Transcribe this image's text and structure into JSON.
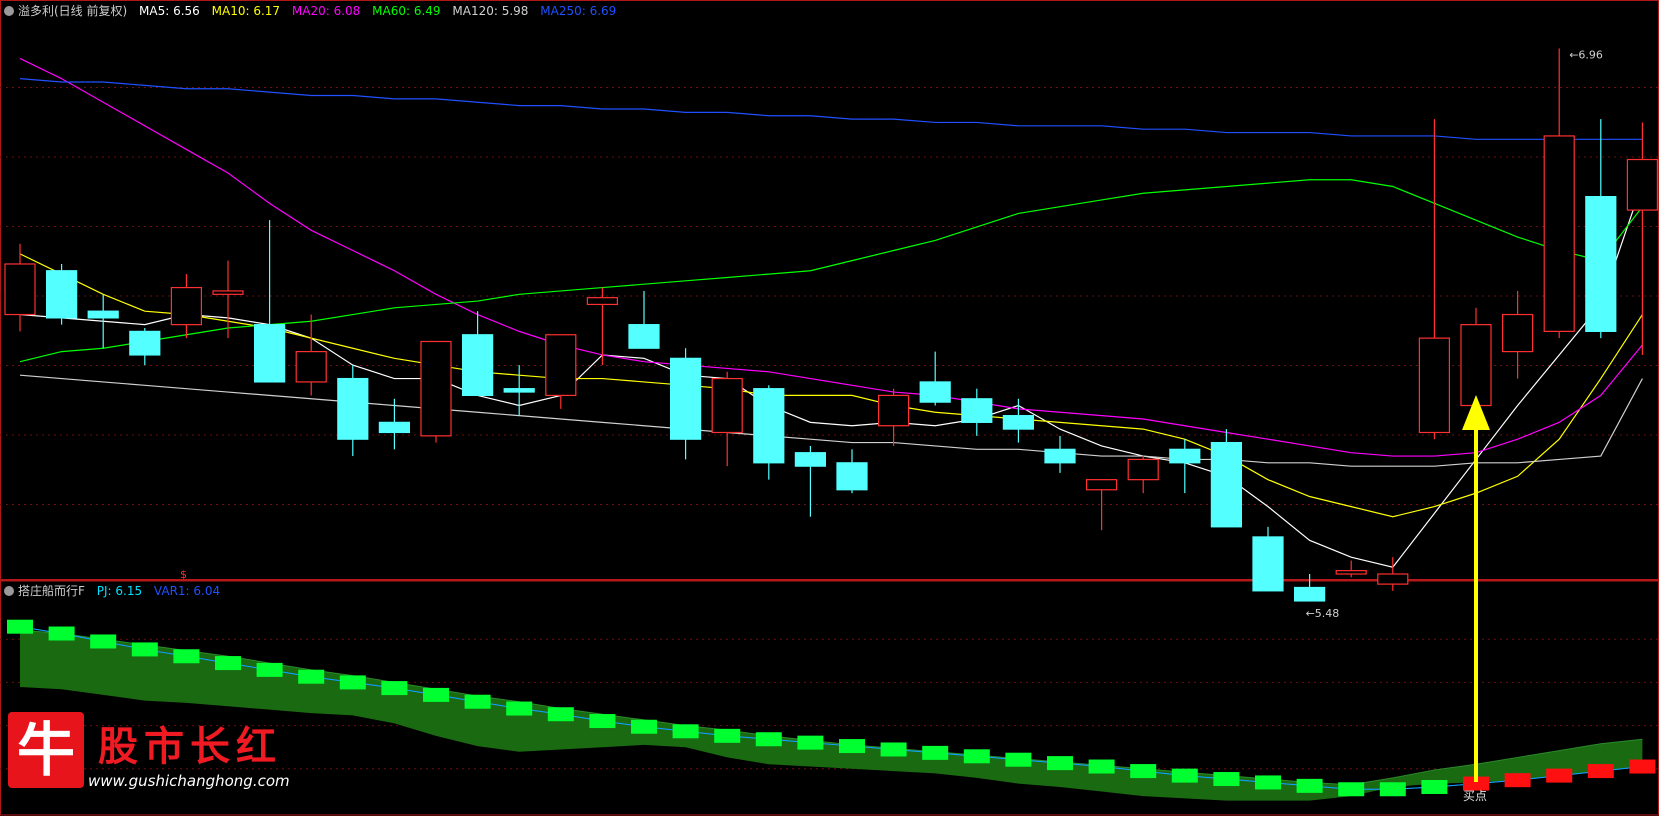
{
  "header": {
    "title": "溢多利(日线 前复权)",
    "indicators": [
      {
        "label": "MA5: 6.56",
        "color": "#ffffff"
      },
      {
        "label": "MA10: 6.17",
        "color": "#ffff00"
      },
      {
        "label": "MA20: 6.08",
        "color": "#ff00ff"
      },
      {
        "label": "MA60: 6.49",
        "color": "#00ff00"
      },
      {
        "label": "MA120: 5.98",
        "color": "#d0d0d0"
      },
      {
        "label": "MA250: 6.69",
        "color": "#2050ff"
      }
    ]
  },
  "subheader": {
    "title": "搭庄船而行F",
    "indicators": [
      {
        "label": "PJ: 6.15",
        "color": "#00e0ff"
      },
      {
        "label": "VAR1: 6.04",
        "color": "#2050ff"
      }
    ]
  },
  "watermark": {
    "logo_char": "牛",
    "name": "股市长红",
    "url": "www.gushichanghong.com"
  },
  "chart_data": [
    {
      "type": "candlestick",
      "panel": "main",
      "ylim": [
        5.4,
        7.05
      ],
      "up_color": "#ff3030",
      "down_color": "#54ffff",
      "candles": [
        {
          "o": 6.17,
          "h": 6.38,
          "l": 6.12,
          "c": 6.32
        },
        {
          "o": 6.3,
          "h": 6.32,
          "l": 6.14,
          "c": 6.16
        },
        {
          "o": 6.18,
          "h": 6.23,
          "l": 6.07,
          "c": 6.16
        },
        {
          "o": 6.12,
          "h": 6.13,
          "l": 6.02,
          "c": 6.05
        },
        {
          "o": 6.14,
          "h": 6.29,
          "l": 6.1,
          "c": 6.25
        },
        {
          "o": 6.23,
          "h": 6.33,
          "l": 6.1,
          "c": 6.24
        },
        {
          "o": 6.14,
          "h": 6.45,
          "l": 5.97,
          "c": 5.97
        },
        {
          "o": 5.97,
          "h": 6.17,
          "l": 5.93,
          "c": 6.06
        },
        {
          "o": 5.98,
          "h": 6.02,
          "l": 5.75,
          "c": 5.8
        },
        {
          "o": 5.85,
          "h": 5.92,
          "l": 5.77,
          "c": 5.82
        },
        {
          "o": 5.81,
          "h": 6.09,
          "l": 5.79,
          "c": 6.09
        },
        {
          "o": 6.11,
          "h": 6.18,
          "l": 5.93,
          "c": 5.93
        },
        {
          "o": 5.95,
          "h": 6.02,
          "l": 5.87,
          "c": 5.94
        },
        {
          "o": 5.93,
          "h": 6.11,
          "l": 5.89,
          "c": 6.11
        },
        {
          "o": 6.2,
          "h": 6.25,
          "l": 6.02,
          "c": 6.22
        },
        {
          "o": 6.14,
          "h": 6.24,
          "l": 6.07,
          "c": 6.07
        },
        {
          "o": 6.04,
          "h": 6.07,
          "l": 5.74,
          "c": 5.8
        },
        {
          "o": 5.82,
          "h": 6.0,
          "l": 5.72,
          "c": 5.98
        },
        {
          "o": 5.95,
          "h": 5.96,
          "l": 5.68,
          "c": 5.73
        },
        {
          "o": 5.76,
          "h": 5.78,
          "l": 5.57,
          "c": 5.72
        },
        {
          "o": 5.73,
          "h": 5.77,
          "l": 5.64,
          "c": 5.65
        },
        {
          "o": 5.84,
          "h": 5.95,
          "l": 5.78,
          "c": 5.93
        },
        {
          "o": 5.97,
          "h": 6.06,
          "l": 5.9,
          "c": 5.91
        },
        {
          "o": 5.92,
          "h": 5.95,
          "l": 5.81,
          "c": 5.85
        },
        {
          "o": 5.87,
          "h": 5.92,
          "l": 5.79,
          "c": 5.83
        },
        {
          "o": 5.77,
          "h": 5.81,
          "l": 5.7,
          "c": 5.73
        },
        {
          "o": 5.65,
          "h": 5.68,
          "l": 5.53,
          "c": 5.68
        },
        {
          "o": 5.68,
          "h": 5.75,
          "l": 5.64,
          "c": 5.74
        },
        {
          "o": 5.77,
          "h": 5.8,
          "l": 5.64,
          "c": 5.73
        },
        {
          "o": 5.79,
          "h": 5.83,
          "l": 5.54,
          "c": 5.54
        },
        {
          "o": 5.51,
          "h": 5.54,
          "l": 5.35,
          "c": 5.35
        },
        {
          "o": 5.36,
          "h": 5.4,
          "l": 5.48,
          "c": 5.32
        },
        {
          "o": 5.4,
          "h": 5.44,
          "l": 5.39,
          "c": 5.41
        },
        {
          "o": 5.37,
          "h": 5.45,
          "l": 5.35,
          "c": 5.4
        },
        {
          "o": 5.82,
          "h": 6.75,
          "l": 5.8,
          "c": 6.1
        },
        {
          "o": 5.9,
          "h": 6.19,
          "l": 5.88,
          "c": 6.14
        },
        {
          "o": 6.06,
          "h": 6.24,
          "l": 5.98,
          "c": 6.17
        },
        {
          "o": 6.12,
          "h": 6.96,
          "l": 6.1,
          "c": 6.7
        },
        {
          "o": 6.52,
          "h": 6.75,
          "l": 6.1,
          "c": 6.12
        },
        {
          "o": 6.48,
          "h": 6.74,
          "l": 6.05,
          "c": 6.63
        }
      ],
      "ma_lines": [
        {
          "name": "MA5",
          "color": "#ffffff",
          "values": [
            6.17,
            6.16,
            6.15,
            6.14,
            6.17,
            6.16,
            6.14,
            6.1,
            6.02,
            5.98,
            5.98,
            5.93,
            5.9,
            5.93,
            6.05,
            6.04,
            5.99,
            5.98,
            5.9,
            5.85,
            5.84,
            5.85,
            5.84,
            5.86,
            5.9,
            5.83,
            5.78,
            5.75,
            5.73,
            5.69,
            5.6,
            5.5,
            5.45,
            5.42,
            5.58,
            5.74,
            5.9,
            6.05,
            6.2,
            6.56
          ]
        },
        {
          "name": "MA10",
          "color": "#ffff00",
          "values": [
            6.35,
            6.29,
            6.23,
            6.18,
            6.17,
            6.15,
            6.13,
            6.1,
            6.07,
            6.04,
            6.02,
            6.0,
            5.99,
            5.98,
            5.98,
            5.97,
            5.96,
            5.95,
            5.93,
            5.93,
            5.93,
            5.9,
            5.88,
            5.87,
            5.86,
            5.85,
            5.84,
            5.83,
            5.8,
            5.75,
            5.68,
            5.63,
            5.6,
            5.57,
            5.6,
            5.64,
            5.69,
            5.8,
            5.98,
            6.17
          ]
        },
        {
          "name": "MA20",
          "color": "#ff00ff",
          "values": [
            6.93,
            6.87,
            6.8,
            6.73,
            6.66,
            6.59,
            6.5,
            6.42,
            6.36,
            6.3,
            6.23,
            6.17,
            6.12,
            6.08,
            6.05,
            6.03,
            6.02,
            6.01,
            6.0,
            5.98,
            5.96,
            5.94,
            5.93,
            5.91,
            5.89,
            5.88,
            5.87,
            5.86,
            5.84,
            5.82,
            5.8,
            5.78,
            5.76,
            5.75,
            5.75,
            5.76,
            5.8,
            5.85,
            5.93,
            6.08
          ]
        },
        {
          "name": "MA60",
          "color": "#00ff00",
          "values": [
            6.03,
            6.06,
            6.07,
            6.09,
            6.11,
            6.13,
            6.14,
            6.15,
            6.17,
            6.19,
            6.2,
            6.21,
            6.23,
            6.24,
            6.25,
            6.26,
            6.27,
            6.28,
            6.29,
            6.3,
            6.33,
            6.36,
            6.39,
            6.43,
            6.47,
            6.49,
            6.51,
            6.53,
            6.54,
            6.55,
            6.56,
            6.57,
            6.57,
            6.55,
            6.5,
            6.45,
            6.4,
            6.36,
            6.33,
            6.49
          ]
        },
        {
          "name": "MA120",
          "color": "#d0d0d0",
          "values": [
            5.99,
            5.98,
            5.97,
            5.96,
            5.95,
            5.94,
            5.93,
            5.92,
            5.91,
            5.9,
            5.89,
            5.88,
            5.87,
            5.86,
            5.85,
            5.84,
            5.83,
            5.82,
            5.81,
            5.8,
            5.79,
            5.79,
            5.78,
            5.77,
            5.77,
            5.76,
            5.75,
            5.75,
            5.74,
            5.74,
            5.73,
            5.73,
            5.72,
            5.72,
            5.72,
            5.73,
            5.73,
            5.74,
            5.75,
            5.98
          ]
        },
        {
          "name": "MA250",
          "color": "#2050ff",
          "values": [
            6.87,
            6.86,
            6.86,
            6.85,
            6.84,
            6.84,
            6.83,
            6.82,
            6.82,
            6.81,
            6.81,
            6.8,
            6.79,
            6.79,
            6.78,
            6.78,
            6.77,
            6.77,
            6.76,
            6.76,
            6.75,
            6.75,
            6.74,
            6.74,
            6.73,
            6.73,
            6.73,
            6.72,
            6.72,
            6.71,
            6.71,
            6.71,
            6.7,
            6.7,
            6.7,
            6.69,
            6.69,
            6.69,
            6.69,
            6.69
          ]
        }
      ],
      "annotations": {
        "high_label": "6.96",
        "low_label": "5.48",
        "arrow_label": "买点",
        "marker_label": "$"
      }
    },
    {
      "type": "bar",
      "panel": "indicator",
      "ylim": [
        5.3,
        7.2
      ],
      "PJ": [
        6.93,
        6.87,
        6.8,
        6.73,
        6.67,
        6.61,
        6.55,
        6.49,
        6.44,
        6.39,
        6.33,
        6.27,
        6.21,
        6.16,
        6.1,
        6.05,
        6.01,
        5.97,
        5.94,
        5.91,
        5.88,
        5.85,
        5.82,
        5.79,
        5.76,
        5.73,
        5.7,
        5.66,
        5.62,
        5.59,
        5.56,
        5.53,
        5.5,
        5.5,
        5.52,
        5.55,
        5.58,
        5.62,
        5.66,
        5.7
      ],
      "VAR1_upper": [
        6.9,
        6.87,
        6.82,
        6.77,
        6.72,
        6.67,
        6.61,
        6.55,
        6.5,
        6.44,
        6.38,
        6.32,
        6.27,
        6.21,
        6.16,
        6.11,
        6.06,
        6.02,
        5.97,
        5.93,
        5.89,
        5.86,
        5.83,
        5.8,
        5.77,
        5.74,
        5.71,
        5.68,
        5.65,
        5.62,
        5.59,
        5.56,
        5.54,
        5.6,
        5.67,
        5.72,
        5.78,
        5.84,
        5.9,
        5.94
      ],
      "VAR1_lower": [
        6.4,
        6.38,
        6.33,
        6.28,
        6.26,
        6.23,
        6.2,
        6.17,
        6.15,
        6.08,
        5.97,
        5.88,
        5.83,
        5.85,
        5.87,
        5.89,
        5.87,
        5.78,
        5.72,
        5.7,
        5.68,
        5.66,
        5.64,
        5.6,
        5.55,
        5.52,
        5.48,
        5.44,
        5.42,
        5.4,
        5.4,
        5.4,
        5.44,
        5.52,
        5.55,
        5.56,
        5.58,
        5.62,
        5.66,
        5.7
      ],
      "bar_colors": {
        "down": "#00ff30",
        "up": "#ff1010"
      }
    }
  ]
}
